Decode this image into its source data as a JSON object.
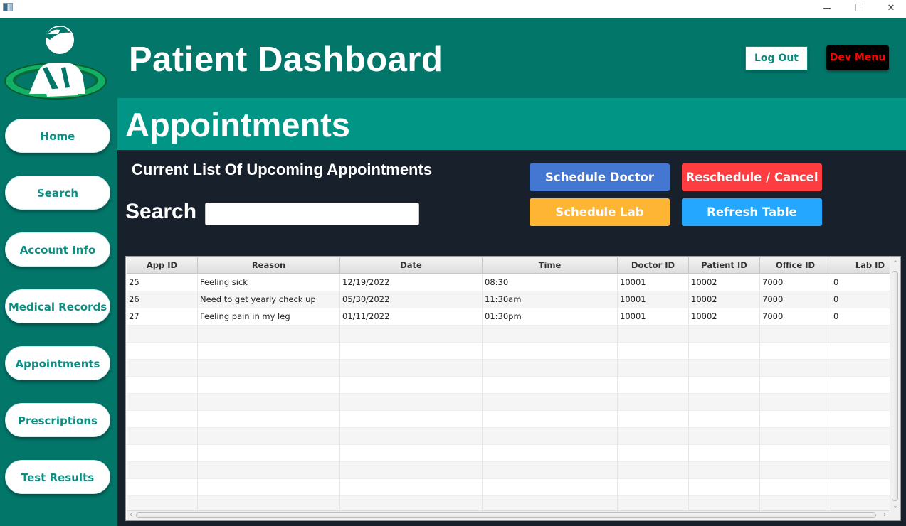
{
  "window": {
    "controls": {
      "minimize": "minimize-icon",
      "maximize": "maximize-icon",
      "close": "✕"
    }
  },
  "header": {
    "title": "Patient Dashboard",
    "logout_label": "Log Out",
    "devmenu_label": "Dev Menu"
  },
  "sidebar": {
    "items": [
      {
        "label": "Home"
      },
      {
        "label": "Search"
      },
      {
        "label": "Account Info"
      },
      {
        "label": "Medical Records"
      },
      {
        "label": "Appointments"
      },
      {
        "label": "Prescriptions"
      },
      {
        "label": "Test Results"
      }
    ]
  },
  "section": {
    "title": "Appointments",
    "subtitle": "Current List Of Upcoming Appointments",
    "search_label": "Search",
    "search_value": "",
    "search_placeholder": ""
  },
  "actions": {
    "schedule_doctor": "Schedule Doctor",
    "reschedule_cancel": "Reschedule / Cancel",
    "schedule_lab": "Schedule Lab",
    "refresh_table": "Refresh Table"
  },
  "colors": {
    "brand_dark": "#03766a",
    "brand": "#019586",
    "content_bg": "#18202b",
    "schedule_doctor": "#4377d2",
    "reschedule_cancel": "#ff3d40",
    "schedule_lab": "#ffb534",
    "refresh_table": "#24a8ff",
    "dev_menu_text": "#ff0000"
  },
  "table": {
    "columns": [
      "App ID",
      "Reason",
      "Date",
      "Time",
      "Doctor ID",
      "Patient ID",
      "Office ID",
      "Lab ID"
    ],
    "rows": [
      [
        "25",
        "Feeling sick",
        "12/19/2022",
        "08:30",
        "10001",
        "10002",
        "7000",
        "0"
      ],
      [
        "26",
        "Need to get yearly check up",
        "05/30/2022",
        "11:30am",
        "10001",
        "10002",
        "7000",
        "0"
      ],
      [
        "27",
        "Feeling pain in my leg",
        "01/11/2022",
        "01:30pm",
        "10001",
        "10002",
        "7000",
        "0"
      ]
    ],
    "empty_rows": 11
  }
}
